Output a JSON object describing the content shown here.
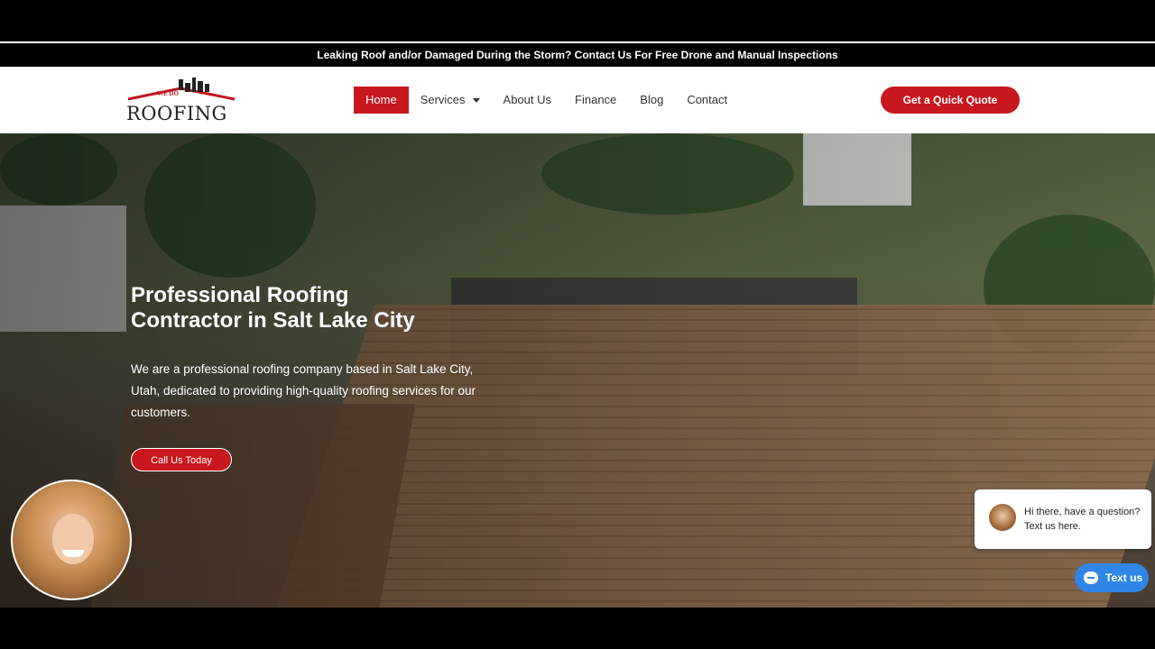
{
  "announcement": "Leaking Roof and/or Damaged During the Storm? Contact Us For Free Drone and Manual Inspections",
  "logo": {
    "small": "WE DO",
    "main": "ROOFING"
  },
  "nav": {
    "items": [
      {
        "label": "Home",
        "active": true
      },
      {
        "label": "Services",
        "active": false
      },
      {
        "label": "About Us",
        "active": false
      },
      {
        "label": "Finance",
        "active": false
      },
      {
        "label": "Blog",
        "active": false
      },
      {
        "label": "Contact",
        "active": false
      }
    ],
    "quote_button": "Get a Quick Quote"
  },
  "hero": {
    "title_line1": "Professional Roofing",
    "title_line2": "Contractor in Salt Lake City",
    "description": "We are a professional roofing company based in Salt Lake City, Utah, dedicated to providing high-quality roofing services for our customers.",
    "cta": "Call Us Today"
  },
  "chat": {
    "message": "Hi there, have a question? Text us here.",
    "button": "Text us"
  },
  "colors": {
    "brand_red": "#c8181e",
    "chat_blue": "#2f86e6"
  },
  "icons": [
    "dropdown-caret-icon",
    "chat-icon"
  ]
}
